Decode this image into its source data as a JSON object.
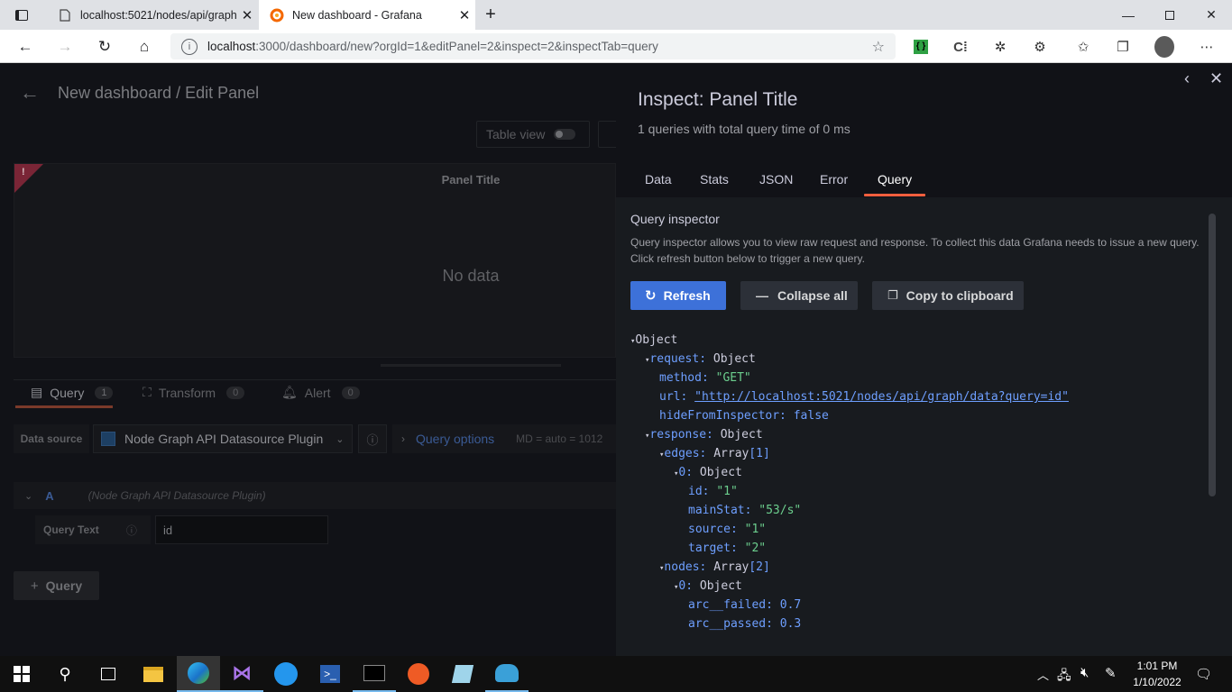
{
  "browser": {
    "tabs": [
      {
        "title": "localhost:5021/nodes/api/graph/",
        "active": false
      },
      {
        "title": "New dashboard - Grafana",
        "active": true
      }
    ],
    "url_host": "localhost",
    "url_rest": ":3000/dashboard/new?orgId=1&editPanel=2&inspect=2&inspectTab=query"
  },
  "grafana": {
    "breadcrumb": "New dashboard / Edit Panel",
    "table_view_label": "Table view",
    "panel_title": "Panel Title",
    "no_data": "No data",
    "editor_tabs": [
      {
        "label": "Query",
        "count": "1"
      },
      {
        "label": "Transform",
        "count": "0"
      },
      {
        "label": "Alert",
        "count": "0"
      }
    ],
    "data_source_label": "Data source",
    "data_source_value": "Node Graph API Datasource Plugin",
    "query_options_label": "Query options",
    "query_options_meta": "MD = auto = 1012",
    "query_letter": "A",
    "query_source": "(Node Graph API Datasource Plugin)",
    "query_text_label": "Query Text",
    "query_text_value": "id",
    "add_query_label": "Query"
  },
  "inspect": {
    "title": "Inspect: Panel Title",
    "subtitle": "1 queries with total query time of 0 ms",
    "tabs": [
      "Data",
      "Stats",
      "JSON",
      "Error",
      "Query"
    ],
    "active_tab": "Query",
    "section_title": "Query inspector",
    "description_1": "Query inspector allows you to view raw request and response. To collect this data Grafana needs to issue a new query.",
    "description_2": "Click refresh button below to trigger a new query.",
    "refresh_label": "Refresh",
    "collapse_label": "Collapse all",
    "copy_label": "Copy to clipboard",
    "tree": {
      "root": "Object",
      "request_key": "request:",
      "request_type": "Object",
      "method_key": "method:",
      "method_val": "\"GET\"",
      "url_key": "url:",
      "url_val": "\"http://localhost:5021/nodes/api/graph/data?query=id\"",
      "hide_key": "hideFromInspector:",
      "hide_val": "false",
      "response_key": "response:",
      "response_type": "Object",
      "edges_key": "edges:",
      "edges_type": "Array",
      "edges_len": "[1]",
      "edge0_key": "0:",
      "edge0_type": "Object",
      "id_key": "id:",
      "id_val": "\"1\"",
      "mainstat_key": "mainStat:",
      "mainstat_val": "\"53/s\"",
      "source_key": "source:",
      "source_val": "\"1\"",
      "target_key": "target:",
      "target_val": "\"2\"",
      "nodes_key": "nodes:",
      "nodes_type": "Array",
      "nodes_len": "[2]",
      "node0_key": "0:",
      "node0_type": "Object",
      "failed_key": "arc__failed:",
      "failed_val": "0.7",
      "passed_key": "arc__passed:",
      "passed_val": "0.3"
    }
  },
  "taskbar": {
    "time": "1:01 PM",
    "date": "1/10/2022"
  },
  "colors": {
    "accent_orange": "#f55f3e",
    "primary_blue": "#3d71d9",
    "string_green": "#6ccf8e",
    "key_blue": "#6e9fff"
  }
}
